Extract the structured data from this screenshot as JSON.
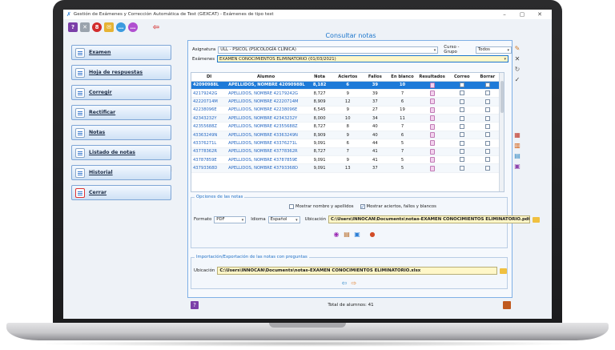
{
  "window": {
    "title": "Gestión de Exámenes y Corrección Automática de Test (GEXCAT) - Exámenes de tipo test",
    "minimize": "–",
    "maximize": "▢",
    "close": "✕"
  },
  "toolbar_icons": [
    "help-icon",
    "tools-icon",
    "stop-icon",
    "folder-icon",
    "chat-icon",
    "chat-icon",
    "back-arrow-icon"
  ],
  "nav": [
    {
      "label": "Examen",
      "icon": "exam-icon"
    },
    {
      "label": "Hoja de respuestas",
      "icon": "answer-sheet-icon"
    },
    {
      "label": "Corregir",
      "icon": "correct-icon"
    },
    {
      "label": "Rectificar",
      "icon": "rectify-icon"
    },
    {
      "label": "Notas",
      "icon": "notes-icon"
    },
    {
      "label": "Listado de notas",
      "icon": "grades-list-icon"
    },
    {
      "label": "Historial",
      "icon": "history-icon"
    },
    {
      "label": "Cerrar",
      "icon": "close-icon"
    }
  ],
  "panel": {
    "title": "Consultar notas",
    "asignatura_label": "Asignatura",
    "asignatura_value": "ULL - PSICOL (PSICOLOGÍA CLÍNICA)",
    "curso_label": "Curso - Grupo",
    "curso_value": "Todos",
    "examenes_label": "Exámenes",
    "examenes_value": "EXAMEN CONOCIMIENTOS ELIMINATORIO (01/03/2021)"
  },
  "table": {
    "headers": [
      "DI",
      "Alumno",
      "Nota",
      "Aciertos",
      "Fallos",
      "En blanco",
      "Resultados",
      "Correo",
      "Borrar"
    ],
    "rows": [
      [
        "42090988L",
        "APELLIDOS, NOMBRE 42090988L",
        "8,182",
        "6",
        "39",
        "10"
      ],
      [
        "42179242G",
        "APELLIDOS, NOMBRE 42179242G",
        "8,727",
        "9",
        "39",
        "7"
      ],
      [
        "42220714M",
        "APELLIDOS, NOMBRE 42220714M",
        "8,909",
        "12",
        "37",
        "6"
      ],
      [
        "42238096E",
        "APELLIDOS, NOMBRE 42238096E",
        "6,545",
        "9",
        "27",
        "19"
      ],
      [
        "42343232Y",
        "APELLIDOS, NOMBRE 42343232Y",
        "8,000",
        "10",
        "34",
        "11"
      ],
      [
        "42355688Z",
        "APELLIDOS, NOMBRE 42355688Z",
        "8,727",
        "8",
        "40",
        "7"
      ],
      [
        "43363249N",
        "APELLIDOS, NOMBRE 43363249N",
        "8,909",
        "9",
        "40",
        "6"
      ],
      [
        "43376271L",
        "APELLIDOS, NOMBRE 43376271L",
        "9,091",
        "6",
        "44",
        "5"
      ],
      [
        "43778362R",
        "APELLIDOS, NOMBRE 43778362R",
        "8,727",
        "7",
        "41",
        "7"
      ],
      [
        "43787859E",
        "APELLIDOS, NOMBRE 43787859E",
        "9,091",
        "9",
        "41",
        "5"
      ],
      [
        "43793368D",
        "APELLIDOS, NOMBRE 43793368D",
        "9,091",
        "13",
        "37",
        "5"
      ]
    ]
  },
  "options": {
    "title": "Opciones de las notas",
    "show_names": "Mostrar nombre y apellidos",
    "show_stats": "Mostrar aciertos, fallos y blancos",
    "format_label": "Formato",
    "format_value": "PDF",
    "language_label": "Idioma",
    "language_value": "Español",
    "location_label": "Ubicación",
    "location_value": "C:\\Users\\INNOCAN\\Documents\\notas-EXAMEN CONOCIMIENTOS ELIMINATORIO.pdf"
  },
  "import_export": {
    "title": "Importación/Exportación de las notas con preguntas",
    "location_label": "Ubicación",
    "location_value": "C:\\Users\\INNOCAN\\Documents\\notas-EXAMEN CONOCIMIENTOS ELIMINATORIO.xlsx"
  },
  "footer": {
    "total": "Total de alumnos: 41"
  },
  "colors": {
    "selected_row": "#1d7ad8",
    "title_blue": "#1c76cc",
    "path_yellow": "#fff7c8"
  }
}
